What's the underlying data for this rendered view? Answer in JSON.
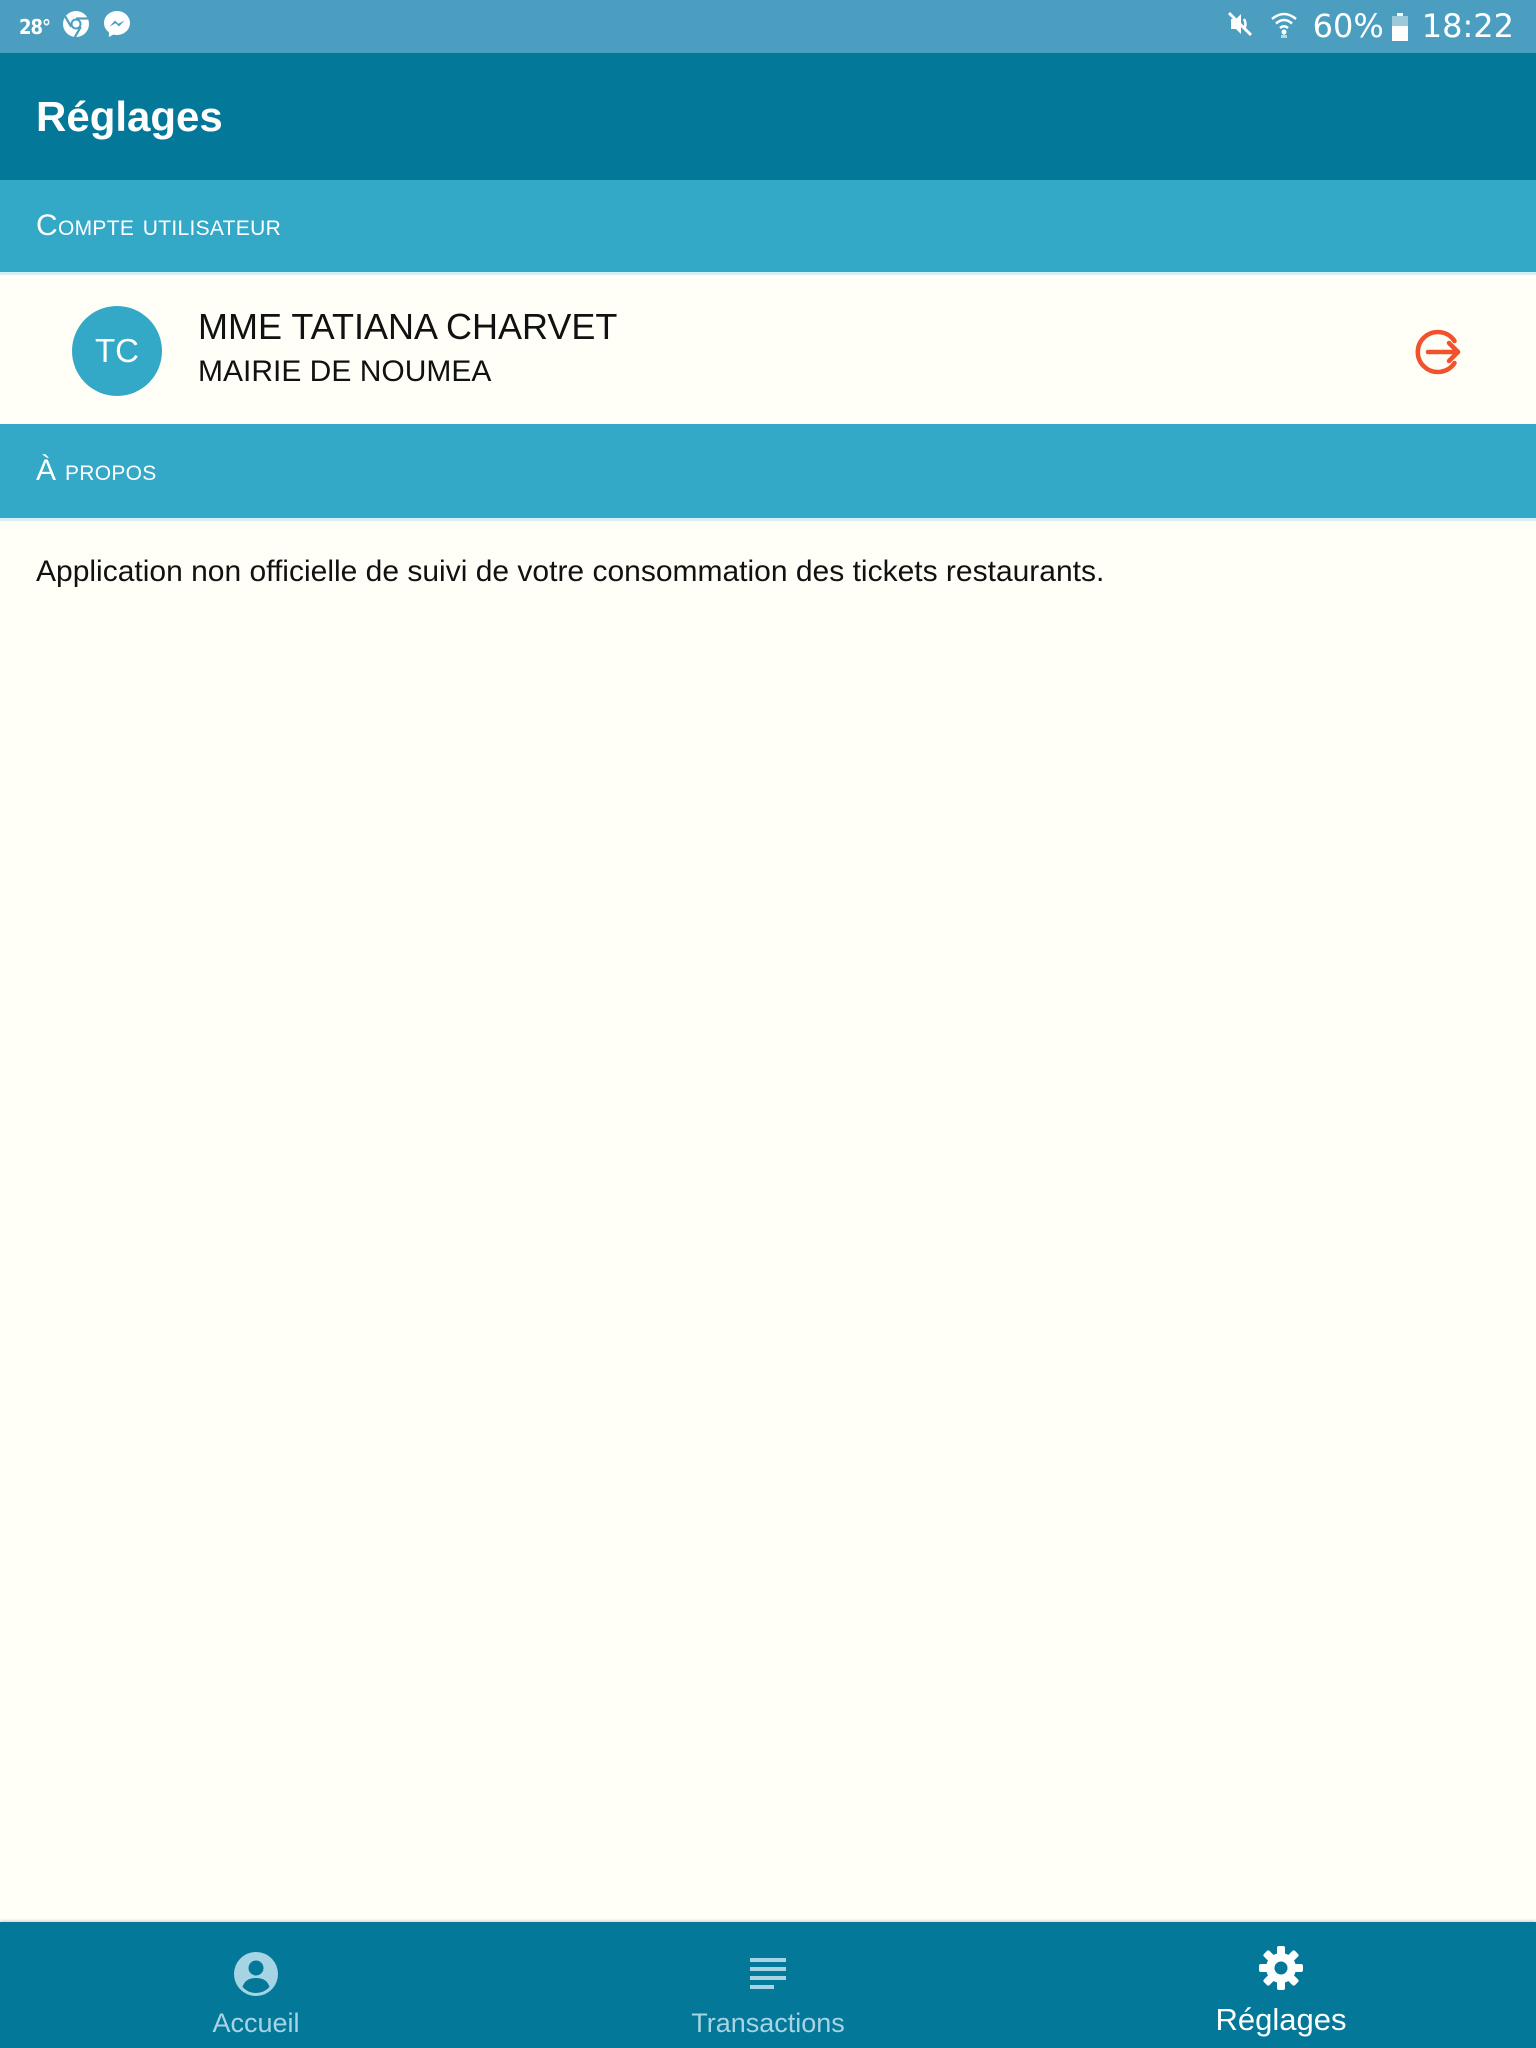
{
  "status_bar": {
    "temperature": "28°",
    "battery": "60%",
    "battery_level": 0.6,
    "time": "18:22",
    "left_icons": [
      "chrome-icon",
      "messenger-icon"
    ],
    "right_icons": [
      "mute-icon",
      "wifi-icon",
      "battery-icon"
    ]
  },
  "app_bar": {
    "title": "Réglages"
  },
  "sections": {
    "account_header": "Compte utilisateur",
    "about_header": "À propos"
  },
  "user": {
    "initials": "TC",
    "name": "MME TATIANA CHARVET",
    "organization": "MAIRIE DE NOUMEA",
    "logout_icon": "logout-icon"
  },
  "about": {
    "text": "Application non officielle de suivi de votre consommation des tickets restaurants."
  },
  "bottom_nav": {
    "items": [
      {
        "label": "Accueil",
        "icon": "account-circle-icon",
        "active": false
      },
      {
        "label": "Transactions",
        "icon": "list-icon",
        "active": false
      },
      {
        "label": "Réglages",
        "icon": "gear-icon",
        "active": true
      }
    ]
  },
  "colors": {
    "status_bar": "#4b9ec0",
    "app_bar": "#037898",
    "section_header": "#34a8c7",
    "background": "#fffef7",
    "logout_accent": "#f0522e",
    "nav_inactive": "#a6d4e4",
    "nav_active": "#ffffff"
  }
}
